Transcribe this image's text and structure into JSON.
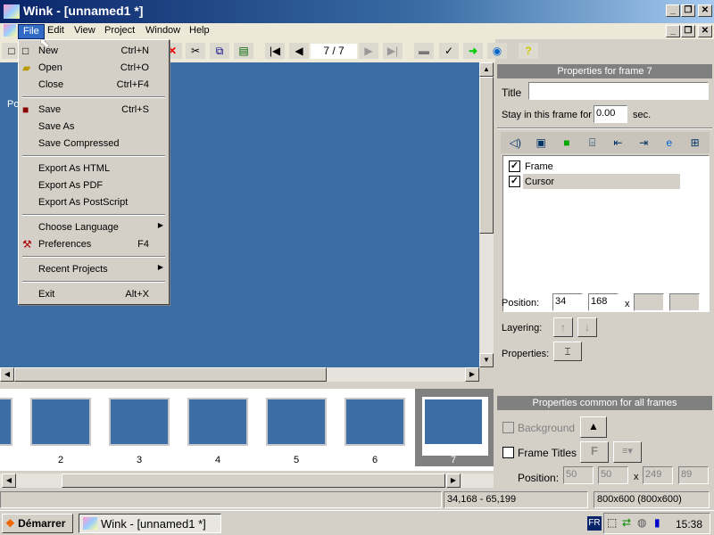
{
  "window": {
    "title": "Wink - [unnamed1 *]",
    "controls": [
      "_",
      "❐",
      "✕"
    ]
  },
  "menubar": [
    "File",
    "Edit",
    "View",
    "Project",
    "Window",
    "Help"
  ],
  "toolbar": {
    "frame_counter": "7 / 7"
  },
  "canvas": {
    "partial_text": "Po"
  },
  "file_menu": {
    "items": [
      {
        "label": "New",
        "shortcut": "Ctrl+N",
        "icon": "new-document-icon"
      },
      {
        "label": "Open",
        "shortcut": "Ctrl+O",
        "icon": "open-folder-icon"
      },
      {
        "label": "Close",
        "shortcut": "Ctrl+F4"
      },
      {
        "label": "Save",
        "shortcut": "Ctrl+S",
        "icon": "save-disk-icon"
      },
      {
        "label": "Save As",
        "shortcut": ""
      },
      {
        "label": "Save Compressed",
        "shortcut": ""
      },
      {
        "label": "Export As HTML",
        "shortcut": ""
      },
      {
        "label": "Export As PDF",
        "shortcut": ""
      },
      {
        "label": "Export As PostScript",
        "shortcut": ""
      },
      {
        "label": "Choose Language",
        "shortcut": "",
        "submenu": true
      },
      {
        "label": "Preferences",
        "shortcut": "F4",
        "icon": "preferences-hammer-icon"
      },
      {
        "label": "Recent Projects",
        "shortcut": "",
        "submenu": true
      },
      {
        "label": "Exit",
        "shortcut": "Alt+X"
      }
    ]
  },
  "frame_props": {
    "header": "Properties for frame 7",
    "title_label": "Title",
    "title_value": "",
    "stay_label": "Stay in this frame for",
    "stay_value": "0.00",
    "stay_unit": "sec.",
    "objects": [
      {
        "label": "Frame",
        "checked": true
      },
      {
        "label": "Cursor",
        "checked": true,
        "selected": true
      }
    ],
    "position_label": "Position:",
    "pos_x": "34",
    "pos_y": "168",
    "pos_w": "",
    "pos_h": "",
    "x_sep": "x",
    "layering_label": "Layering:",
    "properties_label": "Properties:"
  },
  "common_props": {
    "header": "Properties common for all frames",
    "background_label": "Background",
    "frame_titles_label": "Frame Titles",
    "position_label": "Position:",
    "pos_x": "50",
    "pos_y": "50",
    "pos_w": "249",
    "pos_h": "89",
    "x_sep": "x"
  },
  "filmstrip": {
    "frames": [
      "2",
      "3",
      "4",
      "5",
      "6",
      "7"
    ],
    "selected": "7"
  },
  "statusbar": {
    "left": "",
    "coords": "34,168 - 65,199",
    "size": "800x600 (800x600)"
  },
  "taskbar": {
    "start": "Démarrer",
    "task": "Wink - [unnamed1 *]",
    "lang": "FR",
    "clock": "15:38"
  }
}
